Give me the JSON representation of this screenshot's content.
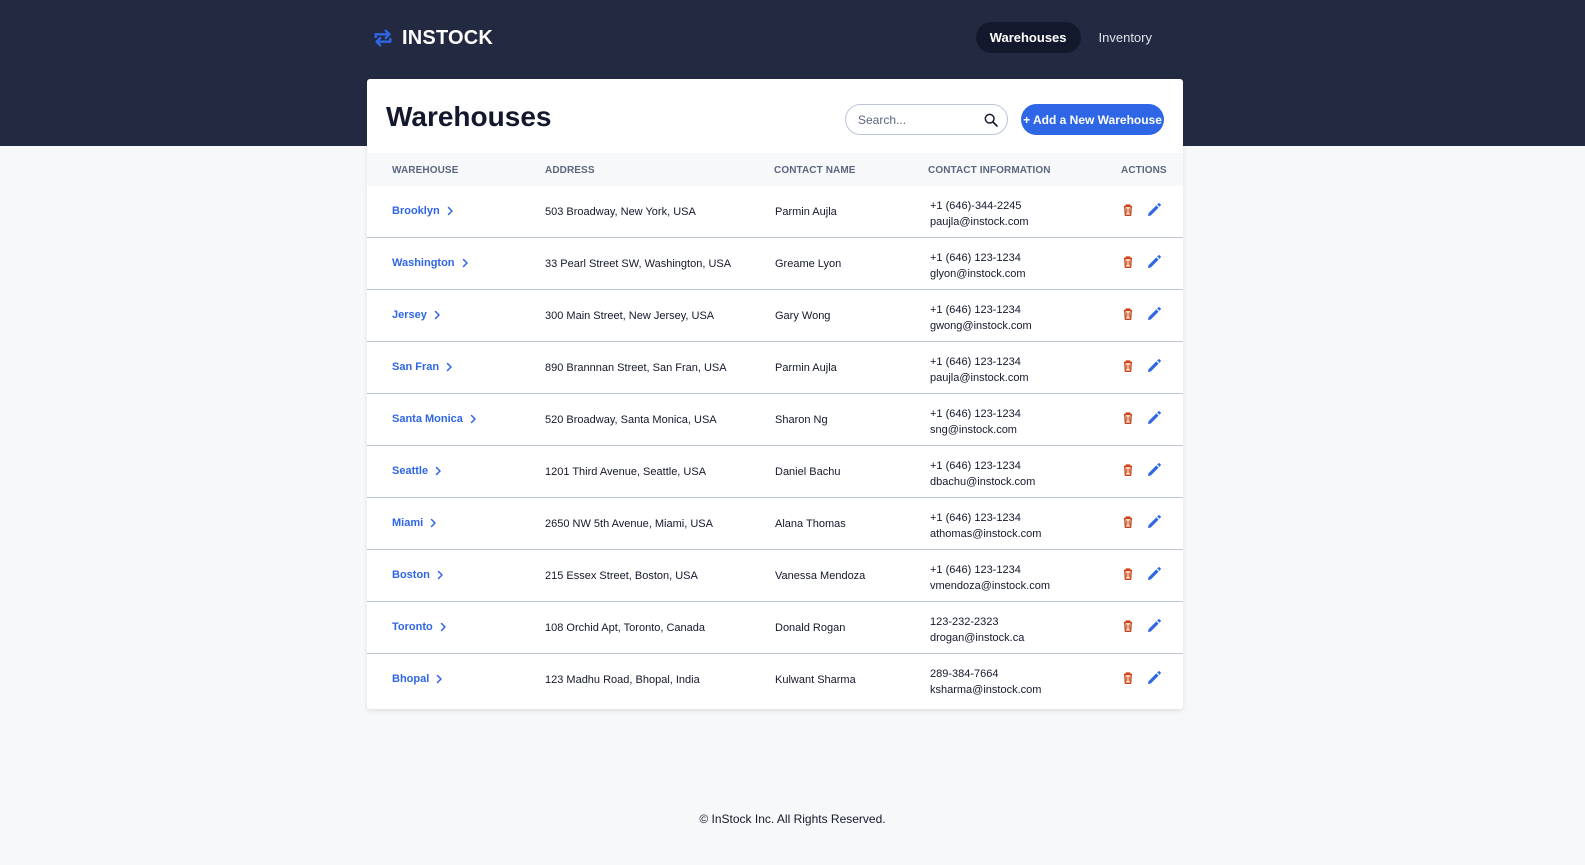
{
  "app": {
    "name": "INSTOCK"
  },
  "nav": [
    {
      "label": "Warehouses",
      "active": true
    },
    {
      "label": "Inventory",
      "active": false
    }
  ],
  "header": {
    "title": "Warehouses",
    "search_placeholder": "Search...",
    "add_label": "+ Add a New Warehouse"
  },
  "table": {
    "columns": [
      "WAREHOUSE",
      "ADDRESS",
      "CONTACT NAME",
      "CONTACT INFORMATION",
      "ACTIONS"
    ],
    "rows": [
      {
        "warehouse": "Brooklyn",
        "address": "503 Broadway, New York, USA",
        "contact": "Parmin Aujla",
        "phone": "+1 (646)-344-2245",
        "email": "paujla@instock.com"
      },
      {
        "warehouse": "Washington",
        "address": "33 Pearl Street SW, Washington, USA",
        "contact": "Greame Lyon",
        "phone": "+1 (646) 123-1234",
        "email": "glyon@instock.com"
      },
      {
        "warehouse": "Jersey",
        "address": "300 Main Street, New Jersey, USA",
        "contact": "Gary Wong",
        "phone": "+1 (646) 123-1234",
        "email": "gwong@instock.com"
      },
      {
        "warehouse": "San Fran",
        "address": "890 Brannnan Street, San Fran, USA",
        "contact": "Parmin Aujla",
        "phone": "+1 (646) 123-1234",
        "email": "paujla@instock.com"
      },
      {
        "warehouse": "Santa Monica",
        "address": "520 Broadway, Santa Monica, USA",
        "contact": "Sharon Ng",
        "phone": "+1 (646) 123-1234",
        "email": "sng@instock.com"
      },
      {
        "warehouse": "Seattle",
        "address": "1201 Third Avenue, Seattle, USA",
        "contact": "Daniel Bachu",
        "phone": "+1 (646) 123-1234",
        "email": "dbachu@instock.com"
      },
      {
        "warehouse": "Miami",
        "address": "2650 NW 5th Avenue, Miami, USA",
        "contact": "Alana Thomas",
        "phone": "+1 (646) 123-1234",
        "email": "athomas@instock.com"
      },
      {
        "warehouse": "Boston",
        "address": "215 Essex Street, Boston, USA",
        "contact": "Vanessa Mendoza",
        "phone": "+1 (646) 123-1234",
        "email": "vmendoza@instock.com"
      },
      {
        "warehouse": "Toronto",
        "address": "108 Orchid Apt, Toronto, Canada",
        "contact": "Donald Rogan",
        "phone": "123-232-2323",
        "email": "drogan@instock.ca"
      },
      {
        "warehouse": "Bhopal",
        "address": "123 Madhu Road, Bhopal, India",
        "contact": "Kulwant Sharma",
        "phone": "289-384-7664",
        "email": "ksharma@instock.com"
      }
    ]
  },
  "footer": {
    "text": "© InStock Inc. All Rights Reserved."
  },
  "colors": {
    "topbar": "#232940",
    "accent": "#2e66e6",
    "delete": "#c94515",
    "text": "#13182c",
    "muted": "#5c667e",
    "divider": "#bdc5d5"
  },
  "icons": {
    "logo": "swap-arrows-icon",
    "search": "search-icon",
    "chevron": "chevron-right-icon",
    "delete": "trash-icon",
    "edit": "pencil-icon"
  }
}
